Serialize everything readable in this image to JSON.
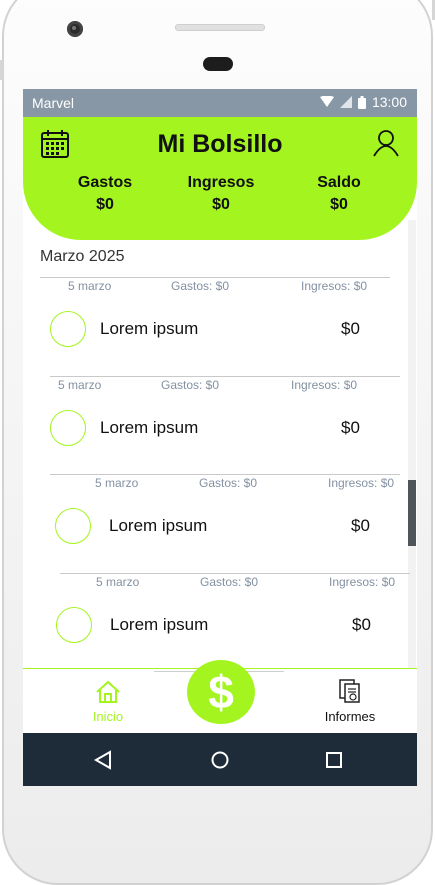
{
  "status": {
    "carrier": "Marvel",
    "time": "13:00"
  },
  "header": {
    "title": "Mi Bolsillo",
    "summary": [
      {
        "label": "Gastos",
        "value": "$0"
      },
      {
        "label": "Ingresos",
        "value": "$0"
      },
      {
        "label": "Saldo",
        "value": "$0"
      }
    ]
  },
  "month": "Marzo 2025",
  "transactions": [
    {
      "date": "5 marzo",
      "gastos": "Gastos: $0",
      "ingresos": "Ingresos: $0",
      "description": "Lorem ipsum",
      "amount": "$0"
    },
    {
      "date": "5 marzo",
      "gastos": "Gastos: $0",
      "ingresos": "Ingresos: $0",
      "description": "Lorem ipsum",
      "amount": "$0"
    },
    {
      "date": "5 marzo",
      "gastos": "Gastos: $0",
      "ingresos": "Ingresos: $0",
      "description": "Lorem ipsum",
      "amount": "$0"
    },
    {
      "date": "5 marzo",
      "gastos": "Gastos: $0",
      "ingresos": "Ingresos: $0",
      "description": "Lorem ipsum",
      "amount": "$0"
    }
  ],
  "bottom_nav": {
    "home_label": "Inicio",
    "fab_symbol": "$",
    "reports_label": "Informes"
  },
  "colors": {
    "accent": "#a4f51f",
    "status_bar": "#8897a6",
    "android_nav": "#1e2b38"
  },
  "icons": [
    "calendar-icon",
    "user-icon",
    "wifi-icon",
    "signal-icon",
    "battery-icon",
    "home-icon",
    "reports-icon",
    "back-icon",
    "home-circle-icon",
    "recents-icon"
  ]
}
